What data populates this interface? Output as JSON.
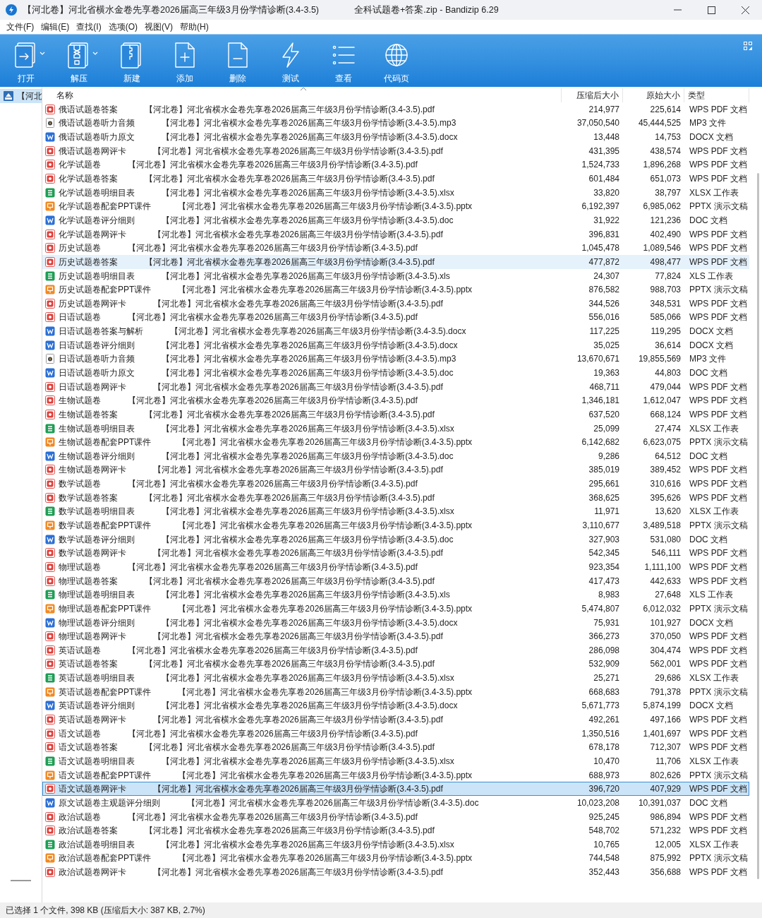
{
  "window": {
    "title": "【河北卷】河北省横水金卷先享卷2026届高三年级3月份学情诊断(3.4-3.5)",
    "app_title": "全科试题卷+答案.zip - Bandizip 6.29"
  },
  "menu": [
    "文件(F)",
    "编辑(E)",
    "查找(I)",
    "选项(O)",
    "视图(V)",
    "帮助(H)"
  ],
  "toolbar": [
    {
      "label": "打开",
      "kind": "open",
      "dropdown": true
    },
    {
      "label": "解压",
      "kind": "extract",
      "dropdown": true
    },
    {
      "label": "新建",
      "kind": "new",
      "dropdown": false
    },
    {
      "label": "添加",
      "kind": "add",
      "dropdown": false
    },
    {
      "label": "删除",
      "kind": "delete",
      "dropdown": false
    },
    {
      "label": "测试",
      "kind": "test",
      "dropdown": false
    },
    {
      "label": "查看",
      "kind": "view",
      "dropdown": false
    },
    {
      "label": "代码页",
      "kind": "codepage",
      "dropdown": false
    }
  ],
  "tree": {
    "label": "【河北",
    "selected": true
  },
  "table": {
    "columns": [
      "名称",
      "压缩后大小",
      "原始大小",
      "类型"
    ],
    "rows": [
      {
        "name": "俄语试题卷答案",
        "file": "【河北卷】河北省横水金卷先享卷2026届高三年级3月份学情诊断(3.4-3.5).pdf",
        "packed": "214,977",
        "size": "225,614",
        "type": "WPS PDF 文档",
        "kind": "pdf",
        "selected": false,
        "hovered": false
      },
      {
        "name": "俄语试题卷听力音频",
        "file": "【河北卷】河北省横水金卷先享卷2026届高三年级3月份学情诊断(3.4-3.5).mp3",
        "packed": "37,050,540",
        "size": "45,444,525",
        "type": "MP3 文件",
        "kind": "audio",
        "selected": false,
        "hovered": false
      },
      {
        "name": "俄语试题卷听力原文",
        "file": "【河北卷】河北省横水金卷先享卷2026届高三年级3月份学情诊断(3.4-3.5).docx",
        "packed": "13,448",
        "size": "14,753",
        "type": "DOCX 文档",
        "kind": "word",
        "selected": false,
        "hovered": false
      },
      {
        "name": "俄语试题卷网评卡",
        "file": "【河北卷】河北省横水金卷先享卷2026届高三年级3月份学情诊断(3.4-3.5).pdf",
        "packed": "431,395",
        "size": "438,574",
        "type": "WPS PDF 文档",
        "kind": "pdf",
        "selected": false,
        "hovered": false
      },
      {
        "name": "化学试题卷",
        "file": "【河北卷】河北省横水金卷先享卷2026届高三年级3月份学情诊断(3.4-3.5).pdf",
        "packed": "1,524,733",
        "size": "1,896,268",
        "type": "WPS PDF 文档",
        "kind": "pdf",
        "selected": false,
        "hovered": false
      },
      {
        "name": "化学试题卷答案",
        "file": "【河北卷】河北省横水金卷先享卷2026届高三年级3月份学情诊断(3.4-3.5).pdf",
        "packed": "601,484",
        "size": "651,073",
        "type": "WPS PDF 文档",
        "kind": "pdf",
        "selected": false,
        "hovered": false
      },
      {
        "name": "化学试题卷明细目表",
        "file": "【河北卷】河北省横水金卷先享卷2026届高三年级3月份学情诊断(3.4-3.5).xlsx",
        "packed": "33,820",
        "size": "38,797",
        "type": "XLSX 工作表",
        "kind": "sheet",
        "selected": false,
        "hovered": false
      },
      {
        "name": "化学试题卷配套PPT课件",
        "file": "【河北卷】河北省横水金卷先享卷2026届高三年级3月份学情诊断(3.4-3.5).pptx",
        "packed": "6,192,397",
        "size": "6,985,062",
        "type": "PPTX 演示文稿",
        "kind": "slides",
        "selected": false,
        "hovered": false
      },
      {
        "name": "化学试题卷评分细则",
        "file": "【河北卷】河北省横水金卷先享卷2026届高三年级3月份学情诊断(3.4-3.5).doc",
        "packed": "31,922",
        "size": "121,236",
        "type": "DOC 文档",
        "kind": "word",
        "selected": false,
        "hovered": false
      },
      {
        "name": "化学试题卷网评卡",
        "file": "【河北卷】河北省横水金卷先享卷2026届高三年级3月份学情诊断(3.4-3.5).pdf",
        "packed": "396,831",
        "size": "402,490",
        "type": "WPS PDF 文档",
        "kind": "pdf",
        "selected": false,
        "hovered": false
      },
      {
        "name": "历史试题卷",
        "file": "【河北卷】河北省横水金卷先享卷2026届高三年级3月份学情诊断(3.4-3.5).pdf",
        "packed": "1,045,478",
        "size": "1,089,546",
        "type": "WPS PDF 文档",
        "kind": "pdf",
        "selected": false,
        "hovered": false
      },
      {
        "name": "历史试题卷答案",
        "file": "【河北卷】河北省横水金卷先享卷2026届高三年级3月份学情诊断(3.4-3.5).pdf",
        "packed": "477,872",
        "size": "498,477",
        "type": "WPS PDF 文档",
        "kind": "pdf",
        "selected": false,
        "hovered": true
      },
      {
        "name": "历史试题卷明细目表",
        "file": "【河北卷】河北省横水金卷先享卷2026届高三年级3月份学情诊断(3.4-3.5).xls",
        "packed": "24,307",
        "size": "77,824",
        "type": "XLS 工作表",
        "kind": "sheet",
        "selected": false,
        "hovered": false
      },
      {
        "name": "历史试题卷配套PPT课件",
        "file": "【河北卷】河北省横水金卷先享卷2026届高三年级3月份学情诊断(3.4-3.5).pptx",
        "packed": "876,582",
        "size": "988,703",
        "type": "PPTX 演示文稿",
        "kind": "slides",
        "selected": false,
        "hovered": false
      },
      {
        "name": "历史试题卷网评卡",
        "file": "【河北卷】河北省横水金卷先享卷2026届高三年级3月份学情诊断(3.4-3.5).pdf",
        "packed": "344,526",
        "size": "348,531",
        "type": "WPS PDF 文档",
        "kind": "pdf",
        "selected": false,
        "hovered": false
      },
      {
        "name": "日语试题卷",
        "file": "【河北卷】河北省横水金卷先享卷2026届高三年级3月份学情诊断(3.4-3.5).pdf",
        "packed": "556,016",
        "size": "585,066",
        "type": "WPS PDF 文档",
        "kind": "pdf",
        "selected": false,
        "hovered": false
      },
      {
        "name": "日语试题卷答案与解析",
        "file": "【河北卷】河北省横水金卷先享卷2026届高三年级3月份学情诊断(3.4-3.5).docx",
        "packed": "117,225",
        "size": "119,295",
        "type": "DOCX 文档",
        "kind": "word",
        "selected": false,
        "hovered": false
      },
      {
        "name": "日语试题卷评分细则",
        "file": "【河北卷】河北省横水金卷先享卷2026届高三年级3月份学情诊断(3.4-3.5).docx",
        "packed": "35,025",
        "size": "36,614",
        "type": "DOCX 文档",
        "kind": "word",
        "selected": false,
        "hovered": false
      },
      {
        "name": "日语试题卷听力音频",
        "file": "【河北卷】河北省横水金卷先享卷2026届高三年级3月份学情诊断(3.4-3.5).mp3",
        "packed": "13,670,671",
        "size": "19,855,569",
        "type": "MP3 文件",
        "kind": "audio",
        "selected": false,
        "hovered": false
      },
      {
        "name": "日语试题卷听力原文",
        "file": "【河北卷】河北省横水金卷先享卷2026届高三年级3月份学情诊断(3.4-3.5).doc",
        "packed": "19,363",
        "size": "44,803",
        "type": "DOC 文档",
        "kind": "word",
        "selected": false,
        "hovered": false
      },
      {
        "name": "日语试题卷网评卡",
        "file": "【河北卷】河北省横水金卷先享卷2026届高三年级3月份学情诊断(3.4-3.5).pdf",
        "packed": "468,711",
        "size": "479,044",
        "type": "WPS PDF 文档",
        "kind": "pdf",
        "selected": false,
        "hovered": false
      },
      {
        "name": "生物试题卷",
        "file": "【河北卷】河北省横水金卷先享卷2026届高三年级3月份学情诊断(3.4-3.5).pdf",
        "packed": "1,346,181",
        "size": "1,612,047",
        "type": "WPS PDF 文档",
        "kind": "pdf",
        "selected": false,
        "hovered": false
      },
      {
        "name": "生物试题卷答案",
        "file": "【河北卷】河北省横水金卷先享卷2026届高三年级3月份学情诊断(3.4-3.5).pdf",
        "packed": "637,520",
        "size": "668,124",
        "type": "WPS PDF 文档",
        "kind": "pdf",
        "selected": false,
        "hovered": false
      },
      {
        "name": "生物试题卷明细目表",
        "file": "【河北卷】河北省横水金卷先享卷2026届高三年级3月份学情诊断(3.4-3.5).xlsx",
        "packed": "25,099",
        "size": "27,474",
        "type": "XLSX 工作表",
        "kind": "sheet",
        "selected": false,
        "hovered": false
      },
      {
        "name": "生物试题卷配套PPT课件",
        "file": "【河北卷】河北省横水金卷先享卷2026届高三年级3月份学情诊断(3.4-3.5).pptx",
        "packed": "6,142,682",
        "size": "6,623,075",
        "type": "PPTX 演示文稿",
        "kind": "slides",
        "selected": false,
        "hovered": false
      },
      {
        "name": "生物试题卷评分细则",
        "file": "【河北卷】河北省横水金卷先享卷2026届高三年级3月份学情诊断(3.4-3.5).doc",
        "packed": "9,286",
        "size": "64,512",
        "type": "DOC 文档",
        "kind": "word",
        "selected": false,
        "hovered": false
      },
      {
        "name": "生物试题卷网评卡",
        "file": "【河北卷】河北省横水金卷先享卷2026届高三年级3月份学情诊断(3.4-3.5).pdf",
        "packed": "385,019",
        "size": "389,452",
        "type": "WPS PDF 文档",
        "kind": "pdf",
        "selected": false,
        "hovered": false
      },
      {
        "name": "数学试题卷",
        "file": "【河北卷】河北省横水金卷先享卷2026届高三年级3月份学情诊断(3.4-3.5).pdf",
        "packed": "295,661",
        "size": "310,616",
        "type": "WPS PDF 文档",
        "kind": "pdf",
        "selected": false,
        "hovered": false
      },
      {
        "name": "数学试题卷答案",
        "file": "【河北卷】河北省横水金卷先享卷2026届高三年级3月份学情诊断(3.4-3.5).pdf",
        "packed": "368,625",
        "size": "395,626",
        "type": "WPS PDF 文档",
        "kind": "pdf",
        "selected": false,
        "hovered": false
      },
      {
        "name": "数学试题卷明细目表",
        "file": "【河北卷】河北省横水金卷先享卷2026届高三年级3月份学情诊断(3.4-3.5).xlsx",
        "packed": "11,971",
        "size": "13,620",
        "type": "XLSX 工作表",
        "kind": "sheet",
        "selected": false,
        "hovered": false
      },
      {
        "name": "数学试题卷配套PPT课件",
        "file": "【河北卷】河北省横水金卷先享卷2026届高三年级3月份学情诊断(3.4-3.5).pptx",
        "packed": "3,110,677",
        "size": "3,489,518",
        "type": "PPTX 演示文稿",
        "kind": "slides",
        "selected": false,
        "hovered": false
      },
      {
        "name": "数学试题卷评分细则",
        "file": "【河北卷】河北省横水金卷先享卷2026届高三年级3月份学情诊断(3.4-3.5).doc",
        "packed": "327,903",
        "size": "531,080",
        "type": "DOC 文档",
        "kind": "word",
        "selected": false,
        "hovered": false
      },
      {
        "name": "数学试题卷网评卡",
        "file": "【河北卷】河北省横水金卷先享卷2026届高三年级3月份学情诊断(3.4-3.5).pdf",
        "packed": "542,345",
        "size": "546,111",
        "type": "WPS PDF 文档",
        "kind": "pdf",
        "selected": false,
        "hovered": false
      },
      {
        "name": "物理试题卷",
        "file": "【河北卷】河北省横水金卷先享卷2026届高三年级3月份学情诊断(3.4-3.5).pdf",
        "packed": "923,354",
        "size": "1,111,100",
        "type": "WPS PDF 文档",
        "kind": "pdf",
        "selected": false,
        "hovered": false
      },
      {
        "name": "物理试题卷答案",
        "file": "【河北卷】河北省横水金卷先享卷2026届高三年级3月份学情诊断(3.4-3.5).pdf",
        "packed": "417,473",
        "size": "442,633",
        "type": "WPS PDF 文档",
        "kind": "pdf",
        "selected": false,
        "hovered": false
      },
      {
        "name": "物理试题卷明细目表",
        "file": "【河北卷】河北省横水金卷先享卷2026届高三年级3月份学情诊断(3.4-3.5).xls",
        "packed": "8,983",
        "size": "27,648",
        "type": "XLS 工作表",
        "kind": "sheet",
        "selected": false,
        "hovered": false
      },
      {
        "name": "物理试题卷配套PPT课件",
        "file": "【河北卷】河北省横水金卷先享卷2026届高三年级3月份学情诊断(3.4-3.5).pptx",
        "packed": "5,474,807",
        "size": "6,012,032",
        "type": "PPTX 演示文稿",
        "kind": "slides",
        "selected": false,
        "hovered": false
      },
      {
        "name": "物理试题卷评分细则",
        "file": "【河北卷】河北省横水金卷先享卷2026届高三年级3月份学情诊断(3.4-3.5).docx",
        "packed": "75,931",
        "size": "101,927",
        "type": "DOCX 文档",
        "kind": "word",
        "selected": false,
        "hovered": false
      },
      {
        "name": "物理试题卷网评卡",
        "file": "【河北卷】河北省横水金卷先享卷2026届高三年级3月份学情诊断(3.4-3.5).pdf",
        "packed": "366,273",
        "size": "370,050",
        "type": "WPS PDF 文档",
        "kind": "pdf",
        "selected": false,
        "hovered": false
      },
      {
        "name": "英语试题卷",
        "file": "【河北卷】河北省横水金卷先享卷2026届高三年级3月份学情诊断(3.4-3.5).pdf",
        "packed": "286,098",
        "size": "304,474",
        "type": "WPS PDF 文档",
        "kind": "pdf",
        "selected": false,
        "hovered": false
      },
      {
        "name": "英语试题卷答案",
        "file": "【河北卷】河北省横水金卷先享卷2026届高三年级3月份学情诊断(3.4-3.5).pdf",
        "packed": "532,909",
        "size": "562,001",
        "type": "WPS PDF 文档",
        "kind": "pdf",
        "selected": false,
        "hovered": false
      },
      {
        "name": "英语试题卷明细目表",
        "file": "【河北卷】河北省横水金卷先享卷2026届高三年级3月份学情诊断(3.4-3.5).xlsx",
        "packed": "25,271",
        "size": "29,686",
        "type": "XLSX 工作表",
        "kind": "sheet",
        "selected": false,
        "hovered": false
      },
      {
        "name": "英语试题卷配套PPT课件",
        "file": "【河北卷】河北省横水金卷先享卷2026届高三年级3月份学情诊断(3.4-3.5).pptx",
        "packed": "668,683",
        "size": "791,378",
        "type": "PPTX 演示文稿",
        "kind": "slides",
        "selected": false,
        "hovered": false
      },
      {
        "name": "英语试题卷评分细则",
        "file": "【河北卷】河北省横水金卷先享卷2026届高三年级3月份学情诊断(3.4-3.5).docx",
        "packed": "5,671,773",
        "size": "5,874,199",
        "type": "DOCX 文档",
        "kind": "word",
        "selected": false,
        "hovered": false
      },
      {
        "name": "英语试题卷网评卡",
        "file": "【河北卷】河北省横水金卷先享卷2026届高三年级3月份学情诊断(3.4-3.5).pdf",
        "packed": "492,261",
        "size": "497,166",
        "type": "WPS PDF 文档",
        "kind": "pdf",
        "selected": false,
        "hovered": false
      },
      {
        "name": "语文试题卷",
        "file": "【河北卷】河北省横水金卷先享卷2026届高三年级3月份学情诊断(3.4-3.5).pdf",
        "packed": "1,350,516",
        "size": "1,401,697",
        "type": "WPS PDF 文档",
        "kind": "pdf",
        "selected": false,
        "hovered": false
      },
      {
        "name": "语文试题卷答案",
        "file": "【河北卷】河北省横水金卷先享卷2026届高三年级3月份学情诊断(3.4-3.5).pdf",
        "packed": "678,178",
        "size": "712,307",
        "type": "WPS PDF 文档",
        "kind": "pdf",
        "selected": false,
        "hovered": false
      },
      {
        "name": "语文试题卷明细目表",
        "file": "【河北卷】河北省横水金卷先享卷2026届高三年级3月份学情诊断(3.4-3.5).xlsx",
        "packed": "10,470",
        "size": "11,706",
        "type": "XLSX 工作表",
        "kind": "sheet",
        "selected": false,
        "hovered": false
      },
      {
        "name": "语文试题卷配套PPT课件",
        "file": "【河北卷】河北省横水金卷先享卷2026届高三年级3月份学情诊断(3.4-3.5).pptx",
        "packed": "688,973",
        "size": "802,626",
        "type": "PPTX 演示文稿",
        "kind": "slides",
        "selected": false,
        "hovered": false
      },
      {
        "name": "语文试题卷网评卡",
        "file": "【河北卷】河北省横水金卷先享卷2026届高三年级3月份学情诊断(3.4-3.5).pdf",
        "packed": "396,720",
        "size": "407,929",
        "type": "WPS PDF 文档",
        "kind": "pdf",
        "selected": true,
        "hovered": false
      },
      {
        "name": "原文试题卷主观题评分细则",
        "file": "【河北卷】河北省横水金卷先享卷2026届高三年级3月份学情诊断(3.4-3.5).doc",
        "packed": "10,023,208",
        "size": "10,391,037",
        "type": "DOC 文档",
        "kind": "word",
        "selected": false,
        "hovered": false
      },
      {
        "name": "政治试题卷",
        "file": "【河北卷】河北省横水金卷先享卷2026届高三年级3月份学情诊断(3.4-3.5).pdf",
        "packed": "925,245",
        "size": "986,894",
        "type": "WPS PDF 文档",
        "kind": "pdf",
        "selected": false,
        "hovered": false
      },
      {
        "name": "政治试题卷答案",
        "file": "【河北卷】河北省横水金卷先享卷2026届高三年级3月份学情诊断(3.4-3.5).pdf",
        "packed": "548,702",
        "size": "571,232",
        "type": "WPS PDF 文档",
        "kind": "pdf",
        "selected": false,
        "hovered": false
      },
      {
        "name": "政治试题卷明细目表",
        "file": "【河北卷】河北省横水金卷先享卷2026届高三年级3月份学情诊断(3.4-3.5).xlsx",
        "packed": "10,765",
        "size": "12,005",
        "type": "XLSX 工作表",
        "kind": "sheet",
        "selected": false,
        "hovered": false
      },
      {
        "name": "政治试题卷配套PPT课件",
        "file": "【河北卷】河北省横水金卷先享卷2026届高三年级3月份学情诊断(3.4-3.5).pptx",
        "packed": "744,548",
        "size": "875,992",
        "type": "PPTX 演示文稿",
        "kind": "slides",
        "selected": false,
        "hovered": false
      },
      {
        "name": "政治试题卷网评卡",
        "file": "【河北卷】河北省横水金卷先享卷2026届高三年级3月份学情诊断(3.4-3.5).pdf",
        "packed": "352,443",
        "size": "356,688",
        "type": "WPS PDF 文档",
        "kind": "pdf",
        "selected": false,
        "hovered": false
      }
    ]
  },
  "status_bar": "已选择 1 个文件, 398 KB (压缩后大小: 387 KB, 2.7%)"
}
